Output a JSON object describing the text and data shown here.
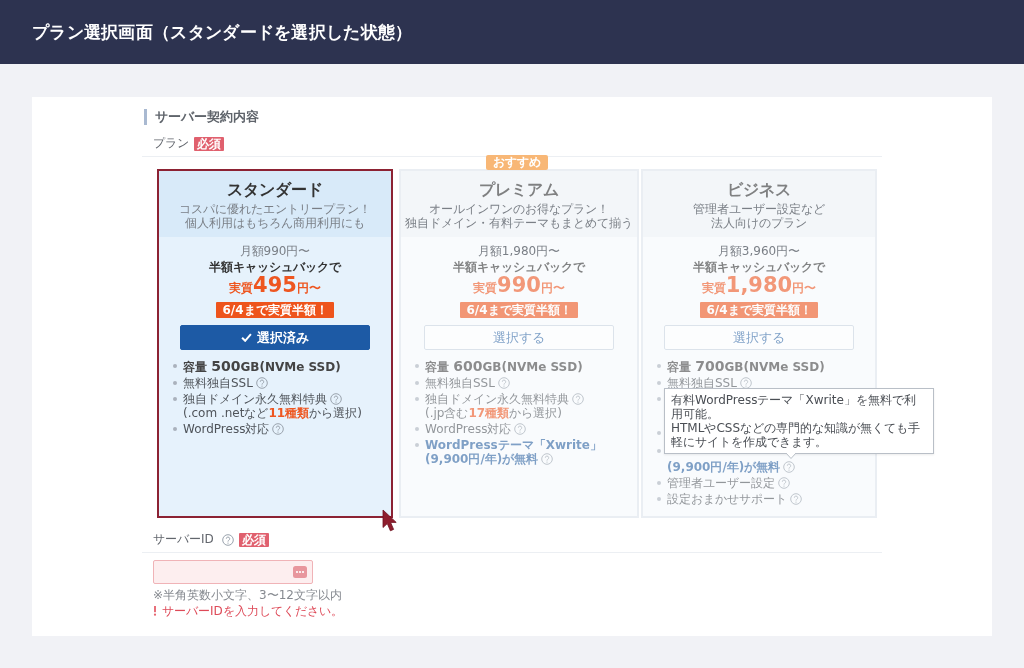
{
  "header": {
    "title": "プラン選択画面（スタンダードを選択した状態）"
  },
  "section": {
    "title": "サーバー契約内容"
  },
  "plan_field": {
    "label": "プラン",
    "badge": "必須"
  },
  "plans": [
    {
      "name": "スタンダード",
      "selected": true,
      "description": [
        "コスパに優れたエントリープラン！",
        "個人利用はもちろん商用利用にも"
      ],
      "monthly": "月額990円〜",
      "cashback": "半額キャッシュバックで",
      "price": "実質**495**円〜",
      "deadline": "6/4まで実質半額！",
      "button": "選択済み",
      "features": [
        {
          "kind": "spec",
          "lines": [
            {
              "kind": "text",
              "text": "容量 **500**GB(NVMe SSD)",
              "help": false
            }
          ]
        },
        {
          "kind": "plain",
          "lines": [
            {
              "kind": "text",
              "text": "無料独自SSL",
              "help": true
            }
          ]
        },
        {
          "kind": "plain",
          "lines": [
            {
              "kind": "text",
              "text": "独自ドメイン永久無料特典",
              "help": true
            },
            {
              "kind": "text",
              "text": "(.com .netなど**11種類**から選択)",
              "help": false
            }
          ]
        },
        {
          "kind": "plain",
          "lines": [
            {
              "kind": "text",
              "text": "WordPress対応",
              "help": true
            }
          ]
        }
      ]
    },
    {
      "name": "プレミアム",
      "selected": false,
      "badge": "おすすめ",
      "description": [
        "オールインワンのお得なプラン！",
        "独自ドメイン・有料テーマもまとめて揃う"
      ],
      "monthly": "月額1,980円〜",
      "cashback": "半額キャッシュバックで",
      "price": "実質**990**円〜",
      "deadline": "6/4まで実質半額！",
      "button": "選択する",
      "features": [
        {
          "kind": "spec",
          "lines": [
            {
              "kind": "text",
              "text": "容量 **600**GB(NVMe SSD)",
              "help": false
            }
          ]
        },
        {
          "kind": "plain",
          "lines": [
            {
              "kind": "text",
              "text": "無料独自SSL",
              "help": true
            }
          ]
        },
        {
          "kind": "plain",
          "lines": [
            {
              "kind": "text",
              "text": "独自ドメイン永久無料特典",
              "help": true
            },
            {
              "kind": "text",
              "text": "(.jp含む**17種類**から選択)",
              "help": false
            }
          ]
        },
        {
          "kind": "plain",
          "lines": [
            {
              "kind": "text",
              "text": "WordPress対応",
              "help": true
            }
          ]
        },
        {
          "kind": "theme",
          "lines": [
            {
              "kind": "text",
              "text": "WordPressテーマ「Xwrite」",
              "help": false
            },
            {
              "kind": "text",
              "text": "(9,900円/年)が**無料**",
              "help": true
            }
          ]
        }
      ]
    },
    {
      "name": "ビジネス",
      "selected": false,
      "description": [
        "管理者ユーザー設定など",
        "法人向けのプラン"
      ],
      "monthly": "月額3,960円〜",
      "cashback": "半額キャッシュバックで",
      "price": "実質**1,980**円〜",
      "deadline": "6/4まで実質半額！",
      "button": "選択する",
      "features": [
        {
          "kind": "spec",
          "lines": [
            {
              "kind": "text",
              "text": "容量 **700**GB(NVMe SSD)",
              "help": false
            }
          ]
        },
        {
          "kind": "plain",
          "lines": [
            {
              "kind": "text",
              "text": "無料独自SSL",
              "help": true
            }
          ]
        },
        {
          "kind": "plain",
          "lines": [
            {
              "kind": "covered"
            },
            {
              "kind": "covered"
            }
          ]
        },
        {
          "kind": "plain",
          "lines": [
            {
              "kind": "covered"
            }
          ]
        },
        {
          "kind": "theme",
          "lines": [
            {
              "kind": "covered"
            },
            {
              "kind": "text",
              "text": "(9,900円/年)が**無料**",
              "help": true,
              "tooltip": [
                "有料WordPressテーマ「Xwrite」を無料で利用可能。",
                "HTMLやCSSなどの専門的な知識が無くても手軽にサイトを作成できます。"
              ]
            }
          ]
        },
        {
          "kind": "plain",
          "lines": [
            {
              "kind": "text",
              "text": "管理者ユーザー設定",
              "help": true
            }
          ]
        },
        {
          "kind": "plain",
          "lines": [
            {
              "kind": "text",
              "text": "設定おまかせサポート",
              "help": true
            }
          ]
        }
      ]
    }
  ],
  "server_id": {
    "label": "サーバーID",
    "help": true,
    "badge": "必須",
    "invalid": true,
    "hint": "※半角英数小文字、3〜12文字以内",
    "error": "サーバーIDを入力してください。"
  }
}
